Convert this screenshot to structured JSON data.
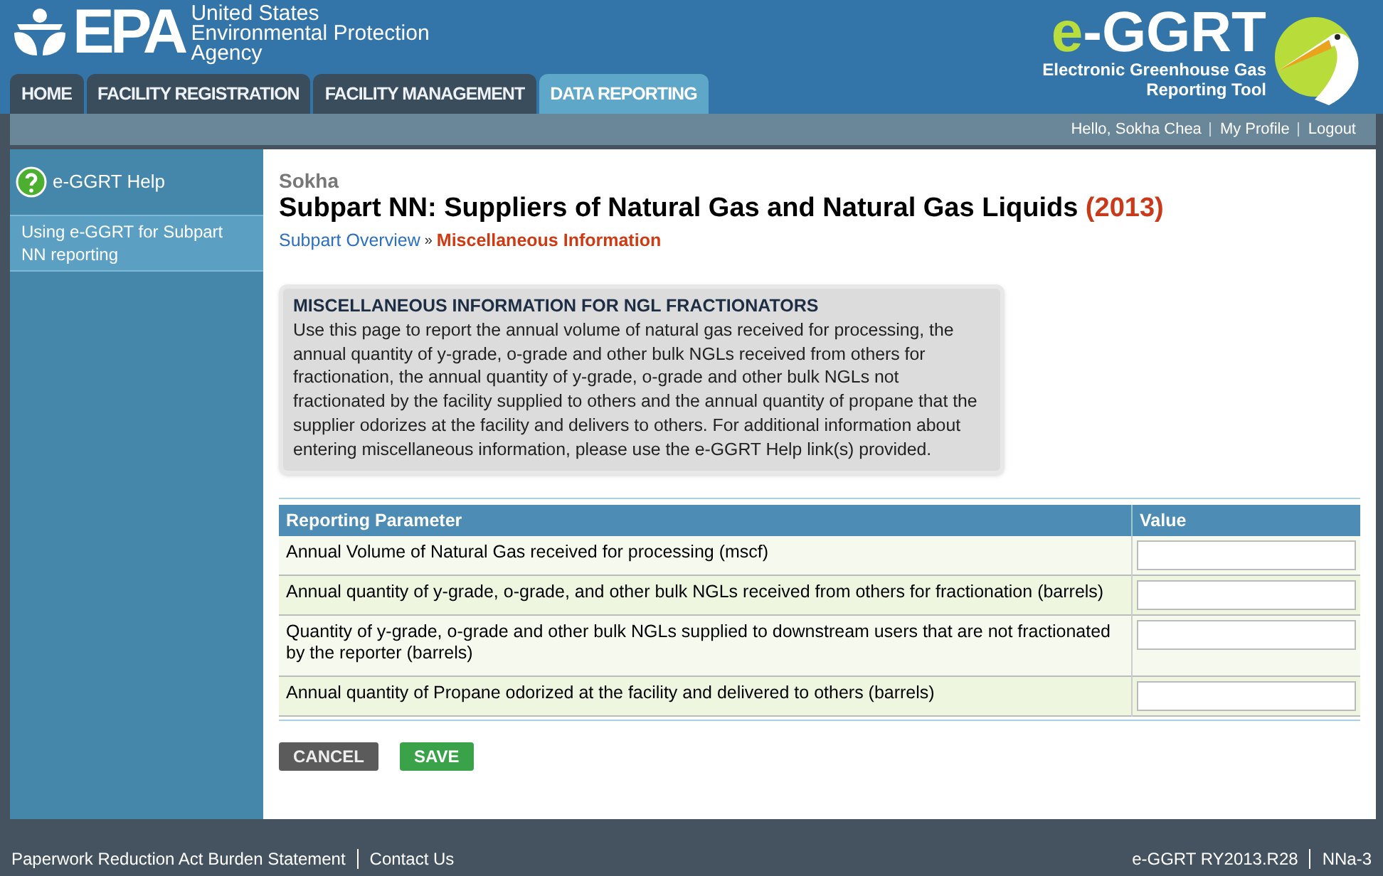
{
  "header": {
    "agency_lines": [
      "United States",
      "Environmental Protection",
      "Agency"
    ],
    "logo_text": "EPA",
    "product_name": "e-GGRT",
    "product_subtitle_lines": [
      "Electronic Greenhouse Gas",
      "Reporting Tool"
    ]
  },
  "tabs": [
    {
      "label": "HOME",
      "selected": false
    },
    {
      "label": "FACILITY REGISTRATION",
      "selected": false
    },
    {
      "label": "FACILITY MANAGEMENT",
      "selected": false
    },
    {
      "label": "DATA REPORTING",
      "selected": true
    }
  ],
  "user_links": [
    "Hello, Sokha Chea",
    "My Profile",
    "Logout"
  ],
  "sidebar": {
    "help_title": "e-GGRT Help",
    "items": [
      {
        "label": "Using e-GGRT for Subpart NN reporting",
        "selected": true
      }
    ]
  },
  "facility": "Sokha",
  "page_title": "Subpart NN: Suppliers of Natural Gas and Natural Gas Liquids",
  "year": "(2013)",
  "breadcrumb": [
    {
      "label": "Subpart Overview",
      "current": false
    },
    {
      "label": "Miscellaneous Information",
      "current": true
    }
  ],
  "breadcrumb_separator": "»",
  "info_box": {
    "title": "MISCELLANEOUS INFORMATION FOR NGL FRACTIONATORS",
    "text": "Use this page to report the annual volume of natural gas received for processing, the annual quantity of y-grade, o-grade and other bulk NGLs received from others for fractionation, the annual quantity of y-grade, o-grade and other bulk NGLs not fractionated by the facility supplied to others and the annual quantity of propane that the supplier odorizes at the facility and delivers to others. For additional information about entering miscellaneous information, please use the e-GGRT Help link(s) provided."
  },
  "table": {
    "columns": [
      "Reporting Parameter",
      "Value"
    ],
    "rows": [
      {
        "parameter": "Annual Volume of Natural Gas received for processing (mscf)"
      },
      {
        "parameter": "Annual quantity of y-grade, o-grade, and other bulk NGLs received from others for fractionation (barrels)"
      },
      {
        "parameter": "Quantity of y-grade, o-grade and other bulk NGLs supplied to downstream users that are not fractionated by the reporter (barrels)"
      },
      {
        "parameter": "Annual quantity of Propane odorized at the facility and delivered to others (barrels)"
      }
    ]
  },
  "buttons": [
    {
      "label": "CANCEL",
      "kind": "cancel"
    },
    {
      "label": "SAVE",
      "kind": "save"
    }
  ],
  "footer": {
    "left_links": [
      "Paperwork Reduction Act Burden Statement",
      "Contact Us"
    ],
    "right_texts": [
      "e-GGRT RY2013.R28",
      "NNa-3"
    ]
  }
}
